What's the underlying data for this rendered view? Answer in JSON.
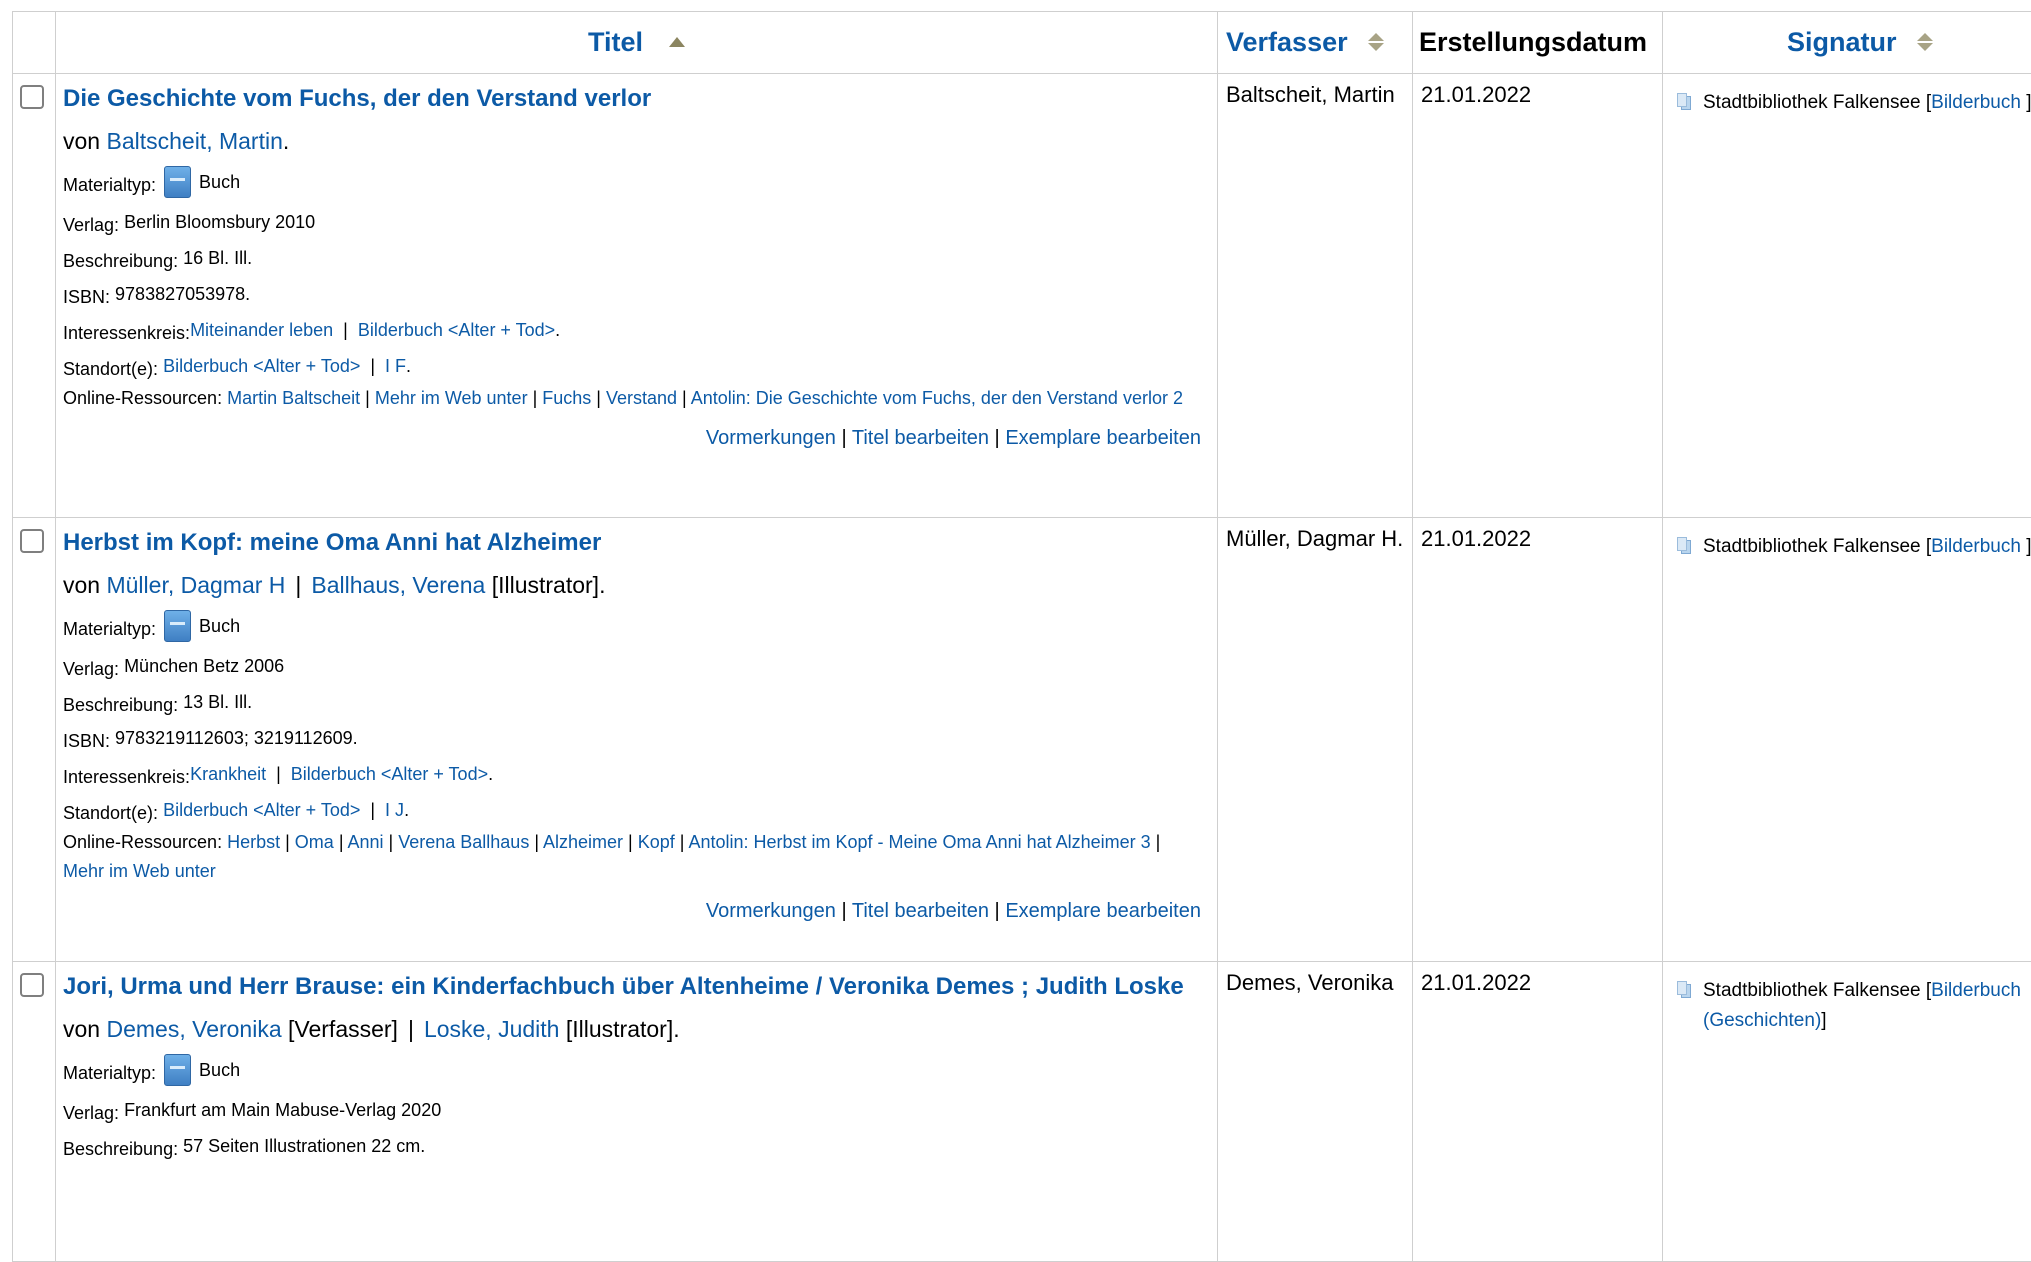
{
  "header": {
    "col_title": "Titel",
    "col_author": "Verfasser",
    "col_date": "Erstellungsdatum",
    "col_signature": "Signatur"
  },
  "labels": {
    "by": "von",
    "materialtyp": "Materialtyp:",
    "verlag": "Verlag:",
    "beschreibung": "Beschreibung:",
    "isbn": "ISBN:",
    "interessenkreis": "Interessenkreis:",
    "standort": "Standort(e):",
    "online": "Online-Ressourcen:",
    "vormerkungen": "Vormerkungen",
    "titel_bearbeiten": "Titel bearbeiten",
    "exemplare_bearbeiten": "Exemplare bearbeiten",
    "library": "Stadtbibliothek Falkensee"
  },
  "records": [
    {
      "title": "Die Geschichte vom Fuchs, der den Verstand verlor",
      "author_link": "Baltscheit, Martin",
      "materialtyp": "Buch",
      "verlag": "Berlin Bloomsbury 2010",
      "beschreibung": "16 Bl. Ill.",
      "isbn": "9783827053978.",
      "interessen_1": "Miteinander leben",
      "interessen_2": "Bilderbuch <Alter + Tod>",
      "standort_1": "Bilderbuch <Alter + Tod>",
      "standort_2": "I F",
      "online": [
        "Martin Baltscheit",
        "Mehr im Web unter",
        "Fuchs",
        "Verstand",
        "Antolin: Die Geschichte vom Fuchs, der den Verstand verlor 2"
      ],
      "author_col": "Baltscheit, Martin",
      "date": "21.01.2022",
      "signature_link": "Bilderbuch",
      "signature_tail": " ]"
    },
    {
      "title": "Herbst im Kopf: meine Oma Anni hat Alzheimer",
      "author_link": "Müller, Dagmar H",
      "author_link2": "Ballhaus, Verena",
      "author_role2": "[Illustrator].",
      "materialtyp": "Buch",
      "verlag": "München Betz 2006",
      "beschreibung": "13 Bl. Ill.",
      "isbn": "9783219112603; 3219112609.",
      "interessen_1": "Krankheit",
      "interessen_2": "Bilderbuch <Alter + Tod>",
      "standort_1": "Bilderbuch <Alter + Tod>",
      "standort_2": "I J",
      "online": [
        "Herbst",
        "Oma",
        "Anni",
        "Verena Ballhaus",
        "Alzheimer",
        "Kopf",
        "Antolin: Herbst im Kopf - Meine Oma Anni hat Alzheimer 3",
        "Mehr im Web unter"
      ],
      "author_col": "Müller, Dagmar H.",
      "date": "21.01.2022",
      "signature_link": "Bilderbuch",
      "signature_tail": " ]"
    },
    {
      "title": "Jori, Urma und Herr Brause: ein Kinderfachbuch über Altenheime / Veronika Demes ; Judith Loske",
      "author_link": "Demes, Veronika",
      "author_role1": "[Verfasser]",
      "author_link2": "Loske, Judith",
      "author_role2": "[Illustrator].",
      "materialtyp": "Buch",
      "verlag": "Frankfurt am Main Mabuse-Verlag 2020",
      "beschreibung": "57 Seiten Illustrationen 22 cm.",
      "author_col": "Demes, Veronika",
      "date": "21.01.2022",
      "signature_link": "Bilderbuch (Geschichten)",
      "signature_tail": "]"
    }
  ]
}
